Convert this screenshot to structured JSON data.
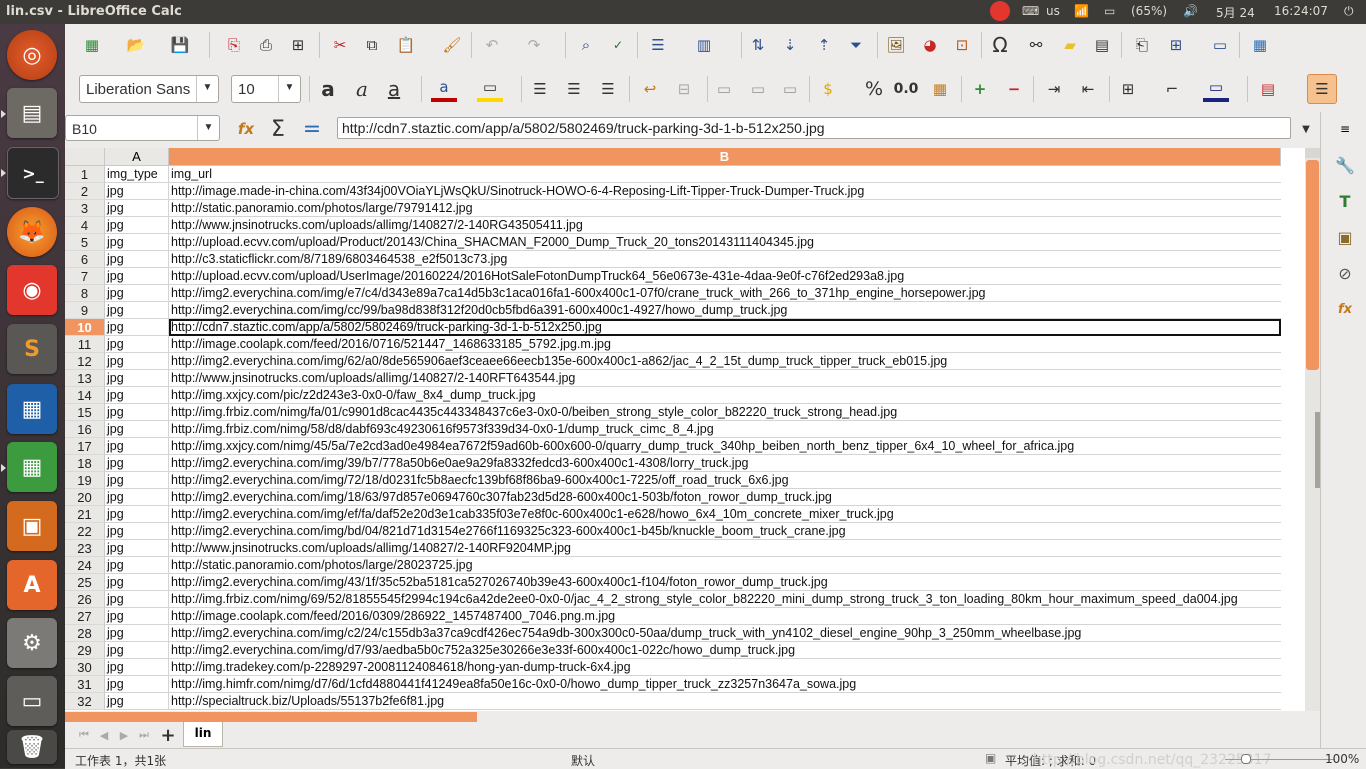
{
  "window": {
    "title": "lin.csv - LibreOffice Calc"
  },
  "panel": {
    "keyboard": "us",
    "battery": "(65%)",
    "date": "5月 24",
    "time": "16:24:07"
  },
  "toolbar": {
    "font_name": "Liberation Sans",
    "font_size": "10",
    "percent": "%",
    "number_format": "0.0",
    "bold_glyph": "a",
    "italic_glyph": "a",
    "underline_glyph": "a"
  },
  "formula_bar": {
    "name_box": "B10",
    "content": "http://cdn7.staztic.com/app/a/5802/5802469/truck-parking-3d-1-b-512x250.jpg"
  },
  "grid": {
    "col_a": "A",
    "col_b": "B",
    "rows": [
      {
        "n": "1",
        "a": "img_type",
        "b": "img_url"
      },
      {
        "n": "2",
        "a": "jpg",
        "b": "http://image.made-in-china.com/43f34j00VOiaYLjWsQkU/Sinotruck-HOWO-6-4-Reposing-Lift-Tipper-Truck-Dumper-Truck.jpg"
      },
      {
        "n": "3",
        "a": "jpg",
        "b": "http://static.panoramio.com/photos/large/79791412.jpg"
      },
      {
        "n": "4",
        "a": "jpg",
        "b": "http://www.jnsinotrucks.com/uploads/allimg/140827/2-140RG43505411.jpg"
      },
      {
        "n": "5",
        "a": "jpg",
        "b": "http://upload.ecvv.com/upload/Product/20143/China_SHACMAN_F2000_Dump_Truck_20_tons20143111404345.jpg"
      },
      {
        "n": "6",
        "a": "jpg",
        "b": "http://c3.staticflickr.com/8/7189/6803464538_e2f5013c73.jpg"
      },
      {
        "n": "7",
        "a": "jpg",
        "b": "http://upload.ecvv.com/upload/UserImage/20160224/2016HotSaleFotonDumpTruck64_56e0673e-431e-4daa-9e0f-c76f2ed293a8.jpg"
      },
      {
        "n": "8",
        "a": "jpg",
        "b": "http://img2.everychina.com/img/e7/c4/d343e89a7ca14d5b3c1aca016fa1-600x400c1-07f0/crane_truck_with_266_to_371hp_engine_horsepower.jpg"
      },
      {
        "n": "9",
        "a": "jpg",
        "b": "http://img2.everychina.com/img/cc/99/ba98d838f312f20d0cb5fbd6a391-600x400c1-4927/howo_dump_truck.jpg"
      },
      {
        "n": "10",
        "a": "jpg",
        "b": "http://cdn7.staztic.com/app/a/5802/5802469/truck-parking-3d-1-b-512x250.jpg"
      },
      {
        "n": "11",
        "a": "jpg",
        "b": "http://image.coolapk.com/feed/2016/0716/521447_1468633185_5792.jpg.m.jpg"
      },
      {
        "n": "12",
        "a": "jpg",
        "b": "http://img2.everychina.com/img/62/a0/8de565906aef3ceaee66eecb135e-600x400c1-a862/jac_4_2_15t_dump_truck_tipper_truck_eb015.jpg"
      },
      {
        "n": "13",
        "a": "jpg",
        "b": "http://www.jnsinotrucks.com/uploads/allimg/140827/2-140RFT643544.jpg"
      },
      {
        "n": "14",
        "a": "jpg",
        "b": "http://img.xxjcy.com/pic/z2d243e3-0x0-0/faw_8x4_dump_truck.jpg"
      },
      {
        "n": "15",
        "a": "jpg",
        "b": "http://img.frbiz.com/nimg/fa/01/c9901d8cac4435c443348437c6e3-0x0-0/beiben_strong_style_color_b82220_truck_strong_head.jpg"
      },
      {
        "n": "16",
        "a": "jpg",
        "b": "http://img.frbiz.com/nimg/58/d8/dabf693c49230616f9573f339d34-0x0-1/dump_truck_cimc_8_4.jpg"
      },
      {
        "n": "17",
        "a": "jpg",
        "b": "http://img.xxjcy.com/nimg/45/5a/7e2cd3ad0e4984ea7672f59ad60b-600x600-0/quarry_dump_truck_340hp_beiben_north_benz_tipper_6x4_10_wheel_for_africa.jpg"
      },
      {
        "n": "18",
        "a": "jpg",
        "b": "http://img2.everychina.com/img/39/b7/778a50b6e0ae9a29fa8332fedcd3-600x400c1-4308/lorry_truck.jpg"
      },
      {
        "n": "19",
        "a": "jpg",
        "b": "http://img2.everychina.com/img/72/18/d0231fc5b8aecfc139bf68f86ba9-600x400c1-7225/off_road_truck_6x6.jpg"
      },
      {
        "n": "20",
        "a": "jpg",
        "b": "http://img2.everychina.com/img/18/63/97d857e0694760c307fab23d5d28-600x400c1-503b/foton_rowor_dump_truck.jpg"
      },
      {
        "n": "21",
        "a": "jpg",
        "b": "http://img2.everychina.com/img/ef/fa/daf52e20d3e1cab335f03e7e8f0c-600x400c1-e628/howo_6x4_10m_concrete_mixer_truck.jpg"
      },
      {
        "n": "22",
        "a": "jpg",
        "b": "http://img2.everychina.com/img/bd/04/821d71d3154e2766f1169325c323-600x400c1-b45b/knuckle_boom_truck_crane.jpg"
      },
      {
        "n": "23",
        "a": "jpg",
        "b": "http://www.jnsinotrucks.com/uploads/allimg/140827/2-140RF9204MP.jpg"
      },
      {
        "n": "24",
        "a": "jpg",
        "b": "http://static.panoramio.com/photos/large/28023725.jpg"
      },
      {
        "n": "25",
        "a": "jpg",
        "b": "http://img2.everychina.com/img/43/1f/35c52ba5181ca527026740b39e43-600x400c1-f104/foton_rowor_dump_truck.jpg"
      },
      {
        "n": "26",
        "a": "jpg",
        "b": "http://img.frbiz.com/nimg/69/52/81855545f2994c194c6a42de2ee0-0x0-0/jac_4_2_strong_style_color_b82220_mini_dump_strong_truck_3_ton_loading_80km_hour_maximum_speed_da004.jpg"
      },
      {
        "n": "27",
        "a": "jpg",
        "b": "http://image.coolapk.com/feed/2016/0309/286922_1457487400_7046.png.m.jpg"
      },
      {
        "n": "28",
        "a": "jpg",
        "b": "http://img2.everychina.com/img/c2/24/c155db3a37ca9cdf426ec754a9db-300x300c0-50aa/dump_truck_with_yn4102_diesel_engine_90hp_3_250mm_wheelbase.jpg"
      },
      {
        "n": "29",
        "a": "jpg",
        "b": "http://img2.everychina.com/img/d7/93/aedba5b0c752a325e30266e3e33f-600x400c1-022c/howo_dump_truck.jpg"
      },
      {
        "n": "30",
        "a": "jpg",
        "b": "http://img.tradekey.com/p-2289297-20081124084618/hong-yan-dump-truck-6x4.jpg"
      },
      {
        "n": "31",
        "a": "jpg",
        "b": "http://img.himfr.com/nimg/d7/6d/1cfd4880441f41249ea8fa50e16c-0x0-0/howo_dump_tipper_truck_zz3257n3647a_sowa.jpg"
      },
      {
        "n": "32",
        "a": "jpg",
        "b": "http://specialtruck.biz/Uploads/55137b2fe6f81.jpg"
      }
    ]
  },
  "sheet_tabs": {
    "active": "lin"
  },
  "status_bar": {
    "sheet": "工作表 1，共1张",
    "style": "默认",
    "summary": "平均值: ; 求和: 0",
    "zoom": "100%",
    "watermark": "http://blog.csdn.net/qq_23225317"
  },
  "colors": {
    "accent": "#f19560",
    "selected_row_header": "#f19560"
  }
}
